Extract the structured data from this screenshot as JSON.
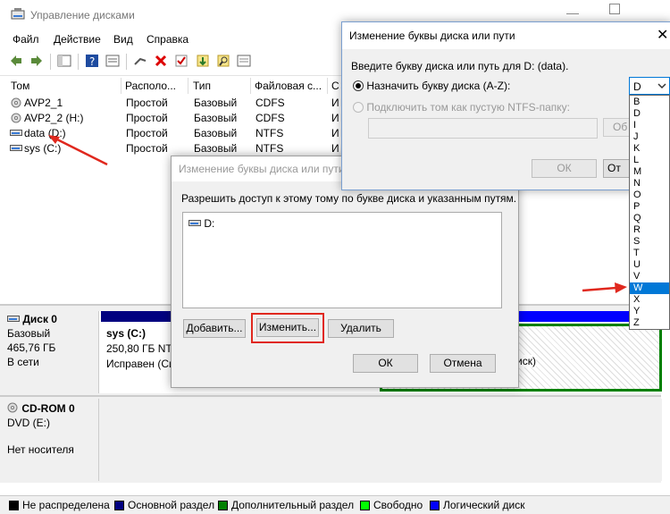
{
  "main": {
    "title": "Управление дисками",
    "menu": [
      "Файл",
      "Действие",
      "Вид",
      "Справка"
    ],
    "columns": [
      "Том",
      "Располо...",
      "Тип",
      "Файловая с...",
      "С"
    ],
    "volumes": [
      {
        "name": "AVP2_1",
        "layout": "Простой",
        "type": "Базовый",
        "fs": "CDFS",
        "status": "И"
      },
      {
        "name": "AVP2_2 (H:)",
        "layout": "Простой",
        "type": "Базовый",
        "fs": "CDFS",
        "status": "И"
      },
      {
        "name": "data (D:)",
        "layout": "Простой",
        "type": "Базовый",
        "fs": "NTFS",
        "status": "И"
      },
      {
        "name": "sys (C:)",
        "layout": "Простой",
        "type": "Базовый",
        "fs": "NTFS",
        "status": "И"
      }
    ],
    "disk0": {
      "name": "Диск 0",
      "type": "Базовый",
      "size": "465,76 ГБ",
      "status": "В сети"
    },
    "partition_c": {
      "name": "sys (C:)",
      "size": "250,80 ГБ NTF",
      "status": "Исправен (Си"
    },
    "partition_d_status": "иск)",
    "cdrom": {
      "name": "CD-ROM 0",
      "drive": "DVD (E:)",
      "status": "Нет носителя"
    },
    "legend": [
      {
        "label": "Не распределена",
        "color": "#000000"
      },
      {
        "label": "Основной раздел",
        "color": "#000080"
      },
      {
        "label": "Дополнительный раздел",
        "color": "#008000"
      },
      {
        "label": "Свободно",
        "color": "#00ff00"
      },
      {
        "label": "Логический диск",
        "color": "#0000ff"
      }
    ]
  },
  "dialog1": {
    "title": "Изменение буквы диска или пути",
    "prompt": "Разрешить доступ к этому тому по букве диска и указанным путям.",
    "list_item": "D:",
    "add": "Добавить...",
    "change": "Изменить...",
    "remove": "Удалить",
    "ok": "ОК",
    "cancel": "Отмена"
  },
  "dialog2": {
    "title": "Изменение буквы диска или пути",
    "prompt": "Введите букву диска или путь для D: (data).",
    "assign_label": "Назначить букву диска (A-Z):",
    "mount_label": "Подключить том как пустую NTFS-папку:",
    "browse": "Об",
    "ok": "ОК",
    "cancel": "От"
  },
  "letter_dropdown": {
    "selected": "D",
    "options": [
      "B",
      "D",
      "I",
      "J",
      "K",
      "L",
      "M",
      "N",
      "O",
      "P",
      "Q",
      "R",
      "S",
      "T",
      "U",
      "V",
      "W",
      "X",
      "Y",
      "Z"
    ],
    "highlighted": "W"
  },
  "annotation_color": "#e0281e"
}
